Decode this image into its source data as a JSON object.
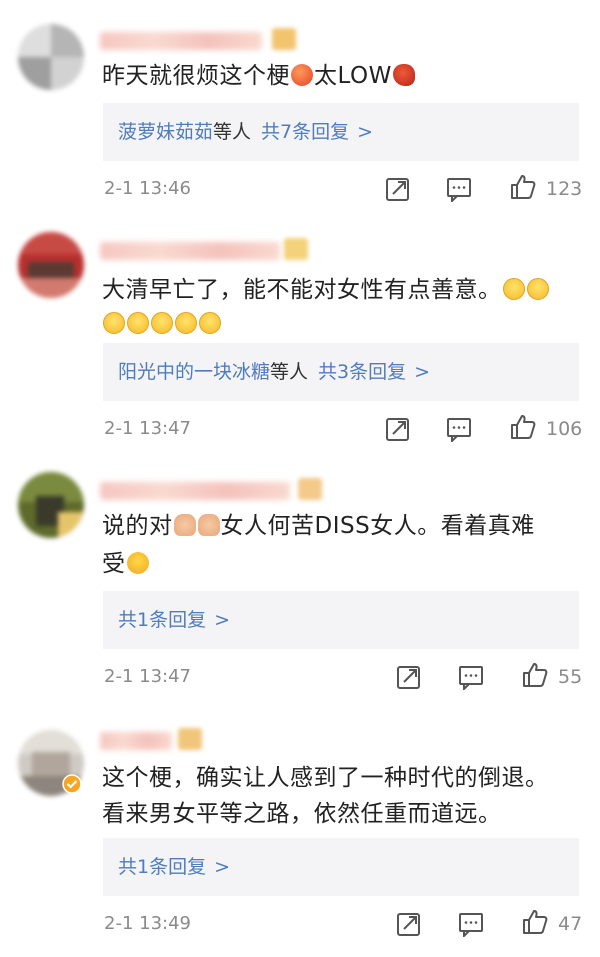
{
  "comments": [
    {
      "text_line1": "昨天就很烦这个梗",
      "text_line1b": "太LOW",
      "reply_names": "菠萝妹茹茹",
      "reply_suffix": "等人",
      "reply_count": "共7条回复",
      "time": "2-1 13:46",
      "likes": "123"
    },
    {
      "text_line1": "大清早亡了，能不能对女性有点善意。",
      "reply_names": "阳光中的一块冰糖",
      "reply_suffix": "等人",
      "reply_count": "共3条回复",
      "time": "2-1 13:47",
      "likes": "106"
    },
    {
      "text_line1a": "说的对",
      "text_line1b": "女人何苦DISS女人。看着真难",
      "text_line2": "受",
      "reply_count": "共1条回复",
      "time": "2-1 13:47",
      "likes": "55"
    },
    {
      "text_line1": "这个梗，确实让人感到了一种时代的倒退。",
      "text_line2": "看来男女平等之路，依然任重而道远。",
      "reply_count": "共1条回复",
      "time": "2-1 13:49",
      "likes": "47"
    }
  ],
  "icons": {
    "repost": "repost-icon",
    "comment": "comment-icon",
    "like": "thumbs-up-icon",
    "chevron": "chevron-right-icon",
    "chevron_glyph": ">"
  },
  "colors": {
    "link": "#4f7dbb",
    "meta": "#8a8a8a",
    "reply_bg": "#f4f4f6"
  }
}
